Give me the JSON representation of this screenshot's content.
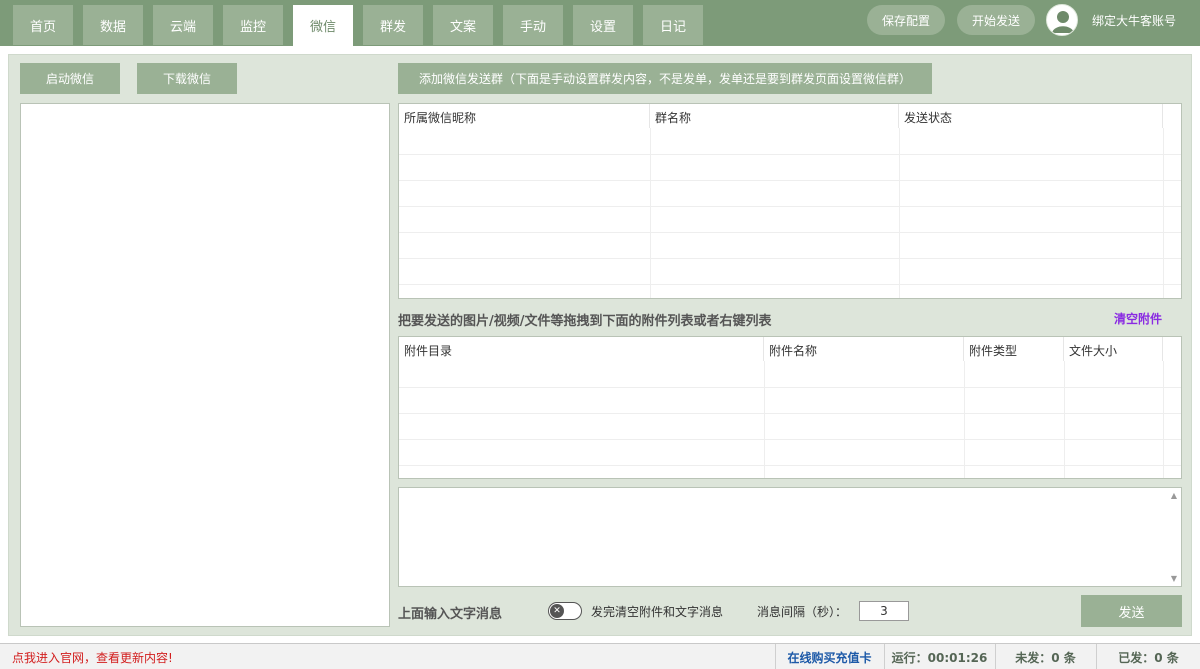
{
  "tabs": [
    {
      "label": "首页"
    },
    {
      "label": "数据"
    },
    {
      "label": "云端"
    },
    {
      "label": "监控"
    },
    {
      "label": "微信",
      "active": true
    },
    {
      "label": "群发"
    },
    {
      "label": "文案"
    },
    {
      "label": "手动"
    },
    {
      "label": "设置"
    },
    {
      "label": "日记"
    }
  ],
  "header": {
    "save_config": "保存配置",
    "start_send": "开始发送",
    "account": "绑定大牛客账号"
  },
  "left": {
    "start_wechat": "启动微信",
    "download_wechat": "下载微信"
  },
  "group": {
    "add_button": "添加微信发送群（下面是手动设置群发内容，不是发单，发单还是要到群发页面设置微信群）",
    "columns": [
      "所属微信昵称",
      "群名称",
      "发送状态"
    ]
  },
  "attachments": {
    "hint": "把要发送的图片/视频/文件等拖拽到下面的附件列表或者右键列表",
    "clear": "清空附件",
    "columns": [
      "附件目录",
      "附件名称",
      "附件类型",
      "文件大小"
    ]
  },
  "message": {
    "input_label": "上面输入文字消息",
    "toggle_label": "发完清空附件和文字消息",
    "interval_label": "消息间隔（秒）：",
    "interval_value": "3",
    "send": "发送"
  },
  "status": {
    "link": "点我进入官网，查看更新内容!",
    "buy": "在线购买充值卡",
    "running": "运行：00:01:26",
    "unsent": "未发：0 条",
    "sent": "已发：0 条"
  },
  "colors": {
    "accent": "#7d9b79",
    "button": "#9ab195",
    "panel": "#dde5da",
    "link_purple": "#8a2be2",
    "status_red": "#d21e1e"
  }
}
